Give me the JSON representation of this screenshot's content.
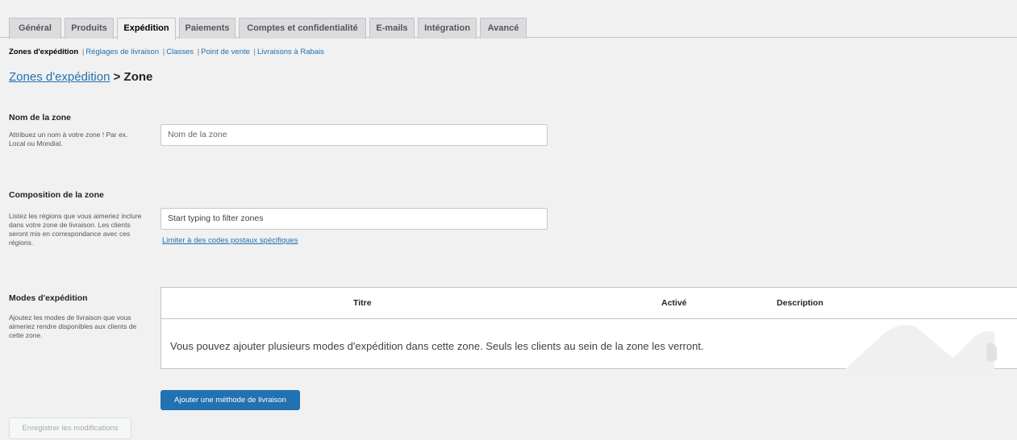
{
  "tabs": [
    {
      "label": "Général"
    },
    {
      "label": "Produits"
    },
    {
      "label": "Expédition"
    },
    {
      "label": "Paiements"
    },
    {
      "label": "Comptes et confidentialité"
    },
    {
      "label": "E-mails"
    },
    {
      "label": "Intégration"
    },
    {
      "label": "Avancé"
    }
  ],
  "subnav": {
    "current": "Zones d'expédition",
    "links": [
      "Réglages de livraison",
      "Classes",
      "Point de vente",
      "Livraisons à Rabais"
    ]
  },
  "breadcrumb": {
    "link": "Zones d'expédition",
    "rest": "> Zone"
  },
  "zone_name": {
    "label": "Nom de la zone",
    "description": "Attribuez un nom à votre zone ! Par ex. Local ou Mondial.",
    "placeholder": "Nom de la zone"
  },
  "zone_regions": {
    "label": "Composition de la zone",
    "description": "Listez les régions que vous aimeriez inclure dans votre zone de livraison. Les clients seront mis en correspondance avec ces régions.",
    "placeholder": "Start typing to filter zones",
    "postcode_link": "Limiter à des codes postaux spécifiques"
  },
  "methods": {
    "label": "Modes d'expédition",
    "description": "Ajoutez les modes de livraison que vous aimeriez rendre disponibles aux clients de cette zone.",
    "columns": {
      "title": "Titre",
      "enabled": "Activé",
      "description": "Description"
    },
    "empty_message": "Vous pouvez ajouter plusieurs modes d'expédition dans cette zone. Seuls les clients au sein de la zone les verront.",
    "add_button": "Ajouter une méthode de livraison"
  },
  "save_button": "Enregistrer les modifications"
}
